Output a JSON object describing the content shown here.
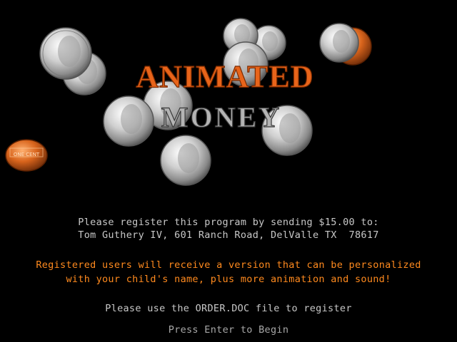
{
  "title": {
    "line1": "ANIMATED",
    "line2": "MONEY"
  },
  "coins": [
    {
      "kind": "quarter"
    },
    {
      "kind": "quarter"
    },
    {
      "kind": "quarter"
    },
    {
      "kind": "quarter"
    },
    {
      "kind": "quarter"
    },
    {
      "kind": "quarter"
    },
    {
      "kind": "quarter"
    },
    {
      "kind": "dime"
    },
    {
      "kind": "dime"
    },
    {
      "kind": "dime"
    },
    {
      "kind": "penny"
    },
    {
      "kind": "penny"
    }
  ],
  "info": {
    "register_line": "Please register this program by sending $15.00 to:",
    "address_line": "Tom Guthery IV, 601 Ranch Road, DelValle TX  78617",
    "registered_line1": "Registered users will receive a version that can be personalized",
    "registered_line2": "with your child's name, plus more animation and sound!",
    "order_line": "Please use the ORDER.DOC file to register",
    "prompt": "Press Enter to Begin"
  },
  "colors": {
    "background": "#000000",
    "text_gray": "#c8c8c8",
    "text_orange": "#ff8a1e",
    "title_orange": "#e8641a",
    "title_silver": "#b4b4b4"
  }
}
